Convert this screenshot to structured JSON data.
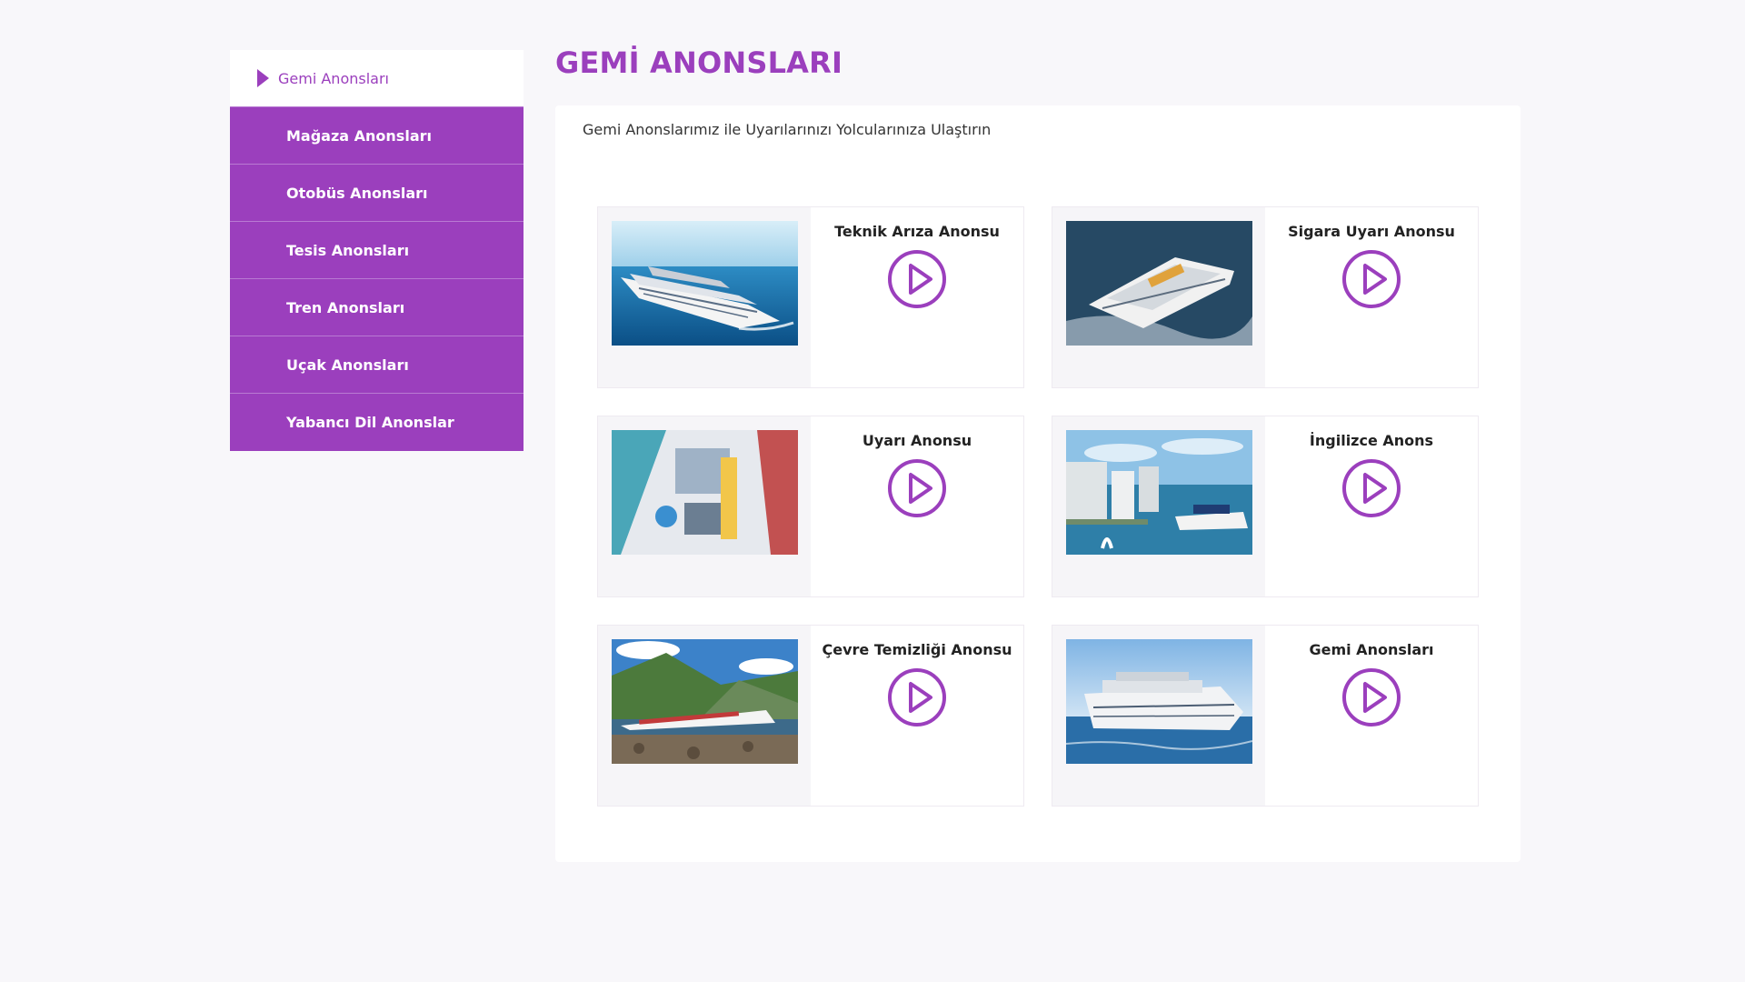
{
  "sidebar": {
    "items": [
      {
        "label": "Gemi Anonsları",
        "active": true
      },
      {
        "label": "Mağaza Anonsları"
      },
      {
        "label": "Otobüs Anonsları"
      },
      {
        "label": "Tesis Anonsları"
      },
      {
        "label": "Tren Anonsları"
      },
      {
        "label": "Uçak Anonsları"
      },
      {
        "label": "Yabancı Dil Anonslar"
      }
    ]
  },
  "main": {
    "title": "GEMİ ANONSLARI",
    "subtitle": "Gemi Anonslarımız ile Uyarılarınızı Yolcularınıza Ulaştırın",
    "cards": [
      {
        "title": "Teknik Arıza Anonsu",
        "image": "cruise-ship-open-sea",
        "icon": "play-icon"
      },
      {
        "title": "Sigara Uyarı Anonsu",
        "image": "cruise-ship-aerial",
        "icon": "play-icon"
      },
      {
        "title": "Uyarı Anonsu",
        "image": "cruise-ship-deck",
        "icon": "play-icon"
      },
      {
        "title": "İngilizce Anons",
        "image": "cruise-ship-harbor-city",
        "icon": "play-icon"
      },
      {
        "title": "Çevre Temizliği Anonsu",
        "image": "cruise-ship-fjord",
        "icon": "play-icon"
      },
      {
        "title": "Gemi Anonsları",
        "image": "cruise-ship-blue-sky",
        "icon": "play-icon"
      }
    ]
  },
  "colors": {
    "accent": "#9b3fbd",
    "background": "#f8f7fa",
    "panel": "#ffffff"
  }
}
